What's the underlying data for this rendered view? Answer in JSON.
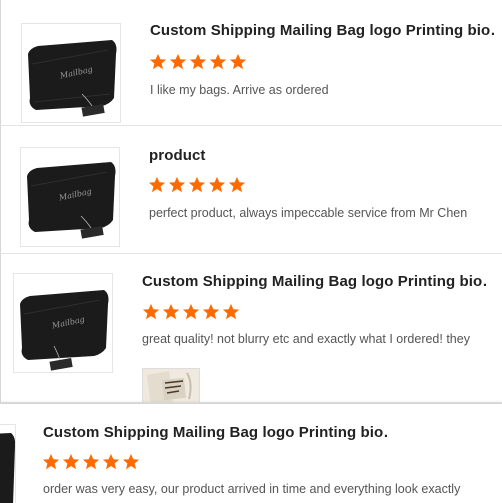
{
  "reviews": [
    {
      "product_title": "Custom Shipping Mailing Bag logo Printing bio…",
      "rating": 5,
      "comment": "I like my bags. Arrive as ordered"
    },
    {
      "product_title": "product",
      "rating": 5,
      "comment": "perfect product, always impeccable service from Mr Chen"
    },
    {
      "product_title": "Custom Shipping Mailing Bag logo Printing bio…",
      "rating": 5,
      "comment": "great quality! not blurry etc and exactly what I ordered! they",
      "has_photo": true
    },
    {
      "product_title": "Custom Shipping Mailing Bag logo Printing bio…",
      "rating": 5,
      "comment": "order was very easy, our product arrived in time and everything look exactly"
    }
  ],
  "colors": {
    "star": "#ff6a00",
    "bag": "#1a1a1a",
    "title": "#222222",
    "comment": "#555555"
  },
  "icons": {
    "star": "star-icon"
  }
}
